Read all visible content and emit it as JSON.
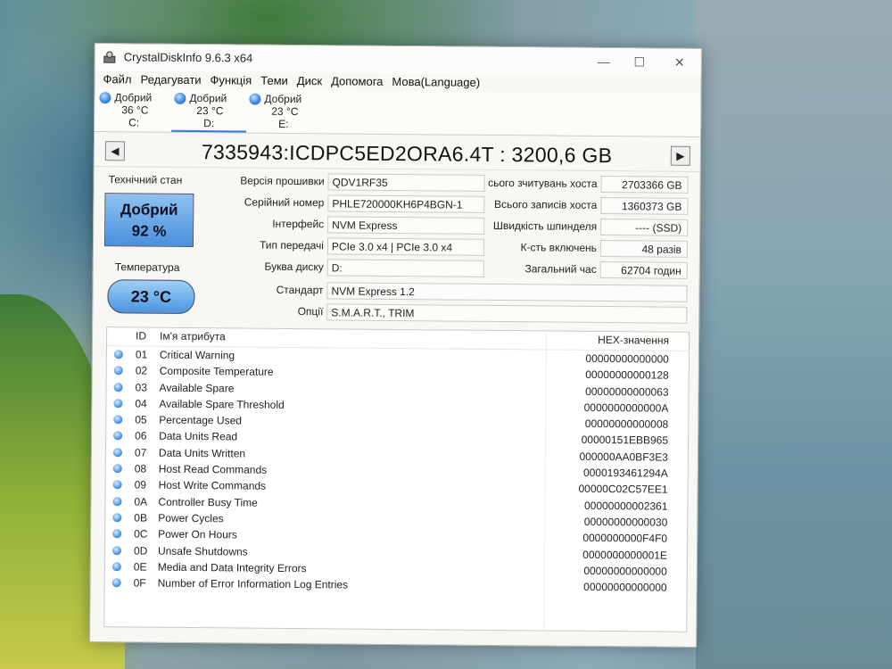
{
  "window": {
    "title": "CrystalDiskInfo 9.6.3 x64",
    "controls": {
      "minimize": "—",
      "maximize": "☐",
      "close": "✕"
    }
  },
  "menu": [
    "Файл",
    "Редагувати",
    "Функція",
    "Теми",
    "Диск",
    "Допомога",
    "Мова(Language)"
  ],
  "disks": [
    {
      "status": "Добрий",
      "temp": "36 °C",
      "letter": "C:"
    },
    {
      "status": "Добрий",
      "temp": "23 °C",
      "letter": "D:"
    },
    {
      "status": "Добрий",
      "temp": "23 °C",
      "letter": "E:"
    }
  ],
  "drive": {
    "title": "7335943:ICDPC5ED2ORA6.4T : 3200,6 GB",
    "prev_icon": "◀",
    "next_icon": "▶"
  },
  "health": {
    "label": "Технічний стан",
    "status": "Добрий",
    "percent": "92 %",
    "temp_label": "Температура",
    "temp": "23 °C"
  },
  "info": {
    "firmware": {
      "label": "Версія прошивки",
      "value": "QDV1RF35"
    },
    "serial": {
      "label": "Серійний номер",
      "value": "PHLE720000KH6P4BGN-1"
    },
    "interface": {
      "label": "Інтерфейс",
      "value": "NVM Express"
    },
    "transfer": {
      "label": "Тип передачі",
      "value": "PCIe 3.0 x4 | PCIe 3.0 x4"
    },
    "drive_letter": {
      "label": "Буква диску",
      "value": "D:"
    },
    "standard": {
      "label": "Стандарт",
      "value": "NVM Express 1.2"
    },
    "features": {
      "label": "Опції",
      "value": "S.M.A.R.T., TRIM"
    },
    "host_reads": {
      "label": "сього зчитувань хоста",
      "value": "2703366 GB"
    },
    "host_writes": {
      "label": "Всього записів хоста",
      "value": "1360373 GB"
    },
    "rotation": {
      "label": "Швидкість шпинделя",
      "value": "---- (SSD)"
    },
    "power_count": {
      "label": "К-сть включень",
      "value": "48 разів"
    },
    "power_hours": {
      "label": "Загальний час",
      "value": "62704 годин"
    }
  },
  "attributes": {
    "headers": {
      "id": "ID",
      "name": "Ім'я атрибута",
      "hex": "HEX-значення"
    },
    "rows": [
      {
        "id": "01",
        "name": "Critical Warning",
        "hex": "00000000000000"
      },
      {
        "id": "02",
        "name": "Composite Temperature",
        "hex": "00000000000128"
      },
      {
        "id": "03",
        "name": "Available Spare",
        "hex": "00000000000063"
      },
      {
        "id": "04",
        "name": "Available Spare Threshold",
        "hex": "0000000000000A"
      },
      {
        "id": "05",
        "name": "Percentage Used",
        "hex": "00000000000008"
      },
      {
        "id": "06",
        "name": "Data Units Read",
        "hex": "00000151EBB965"
      },
      {
        "id": "07",
        "name": "Data Units Written",
        "hex": "000000AA0BF3E3"
      },
      {
        "id": "08",
        "name": "Host Read Commands",
        "hex": "0000193461294A"
      },
      {
        "id": "09",
        "name": "Host Write Commands",
        "hex": "00000C02C57EE1"
      },
      {
        "id": "0A",
        "name": "Controller Busy Time",
        "hex": "00000000002361"
      },
      {
        "id": "0B",
        "name": "Power Cycles",
        "hex": "00000000000030"
      },
      {
        "id": "0C",
        "name": "Power On Hours",
        "hex": "0000000000F4F0"
      },
      {
        "id": "0D",
        "name": "Unsafe Shutdowns",
        "hex": "0000000000001E"
      },
      {
        "id": "0E",
        "name": "Media and Data Integrity Errors",
        "hex": "00000000000000"
      },
      {
        "id": "0F",
        "name": "Number of Error Information Log Entries",
        "hex": "00000000000000"
      }
    ]
  }
}
